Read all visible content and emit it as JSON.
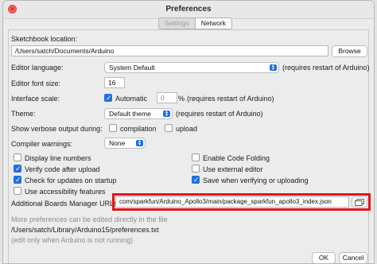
{
  "window": {
    "title": "Preferences"
  },
  "tabs": [
    {
      "label": "Settings"
    },
    {
      "label": "Network"
    }
  ],
  "sketchbook": {
    "label": "Sketchbook location:",
    "path": "/Users/satch/Documents/Arduino",
    "browse": "Browse"
  },
  "editor_language": {
    "label": "Editor language:",
    "value": "System Default",
    "note": "(requires restart of Arduino)"
  },
  "font_size": {
    "label": "Editor font size:",
    "value": "16"
  },
  "interface_scale": {
    "label": "Interface scale:",
    "automatic": "Automatic",
    "value": "0",
    "unit": "%",
    "note": "(requires restart of Arduino)"
  },
  "theme": {
    "label": "Theme:",
    "value": "Default theme",
    "note": "(requires restart of Arduino)"
  },
  "verbose": {
    "label": "Show verbose output during:",
    "compilation": "compilation",
    "upload": "upload"
  },
  "warnings": {
    "label": "Compiler warnings:",
    "value": "None"
  },
  "options_left": [
    {
      "label": "Display line numbers",
      "checked": false
    },
    {
      "label": "Verify code after upload",
      "checked": true
    },
    {
      "label": "Check for updates on startup",
      "checked": true
    },
    {
      "label": "Use accessibility features",
      "checked": false
    }
  ],
  "options_right": [
    {
      "label": "Enable Code Folding",
      "checked": false
    },
    {
      "label": "Use external editor",
      "checked": false
    },
    {
      "label": "Save when verifying or uploading",
      "checked": true
    }
  ],
  "boards_urls": {
    "label": "Additional Boards Manager URLs:",
    "value": "com/sparkfun/Arduino_Apollo3/main/package_sparkfun_apollo3_index.json"
  },
  "footer": {
    "more_prefs": "More preferences can be edited directly in the file",
    "prefs_path": "/Users/satch/Library/Arduino15/preferences.txt",
    "edit_note": "(edit only when Arduino is not running)",
    "ok": "OK",
    "cancel": "Cancel"
  },
  "colors": {
    "accent": "#1f6fe5",
    "highlight": "#e3151b"
  }
}
